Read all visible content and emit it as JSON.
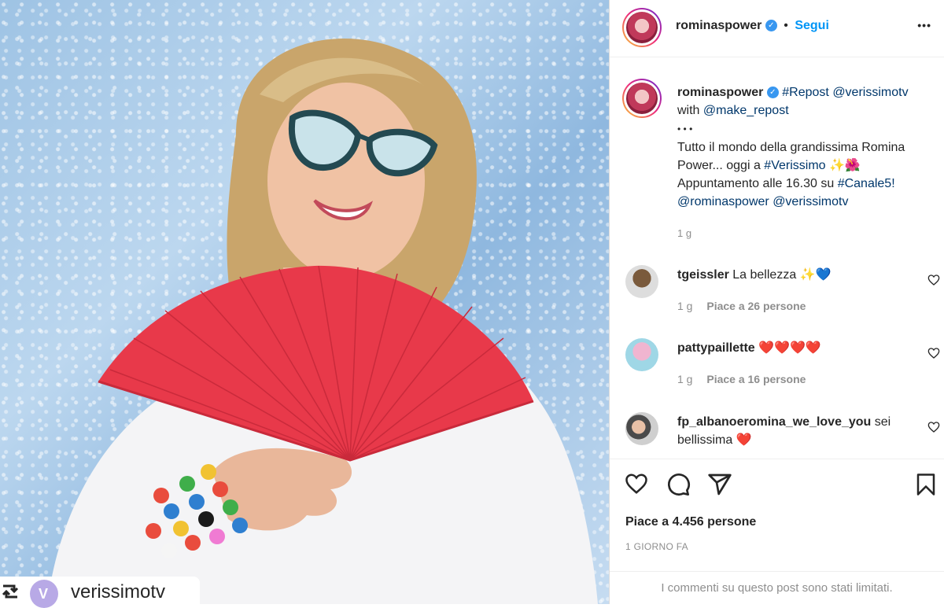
{
  "header": {
    "username": "rominaspower",
    "follow_label": "Segui",
    "more_label": "•••"
  },
  "caption": {
    "username": "rominaspower",
    "hashtag_repost": "#Repost",
    "mention_verissimotv": "@verissimotv",
    "with_text": "with",
    "mention_make_repost": "@make_repost",
    "dots": "• • •",
    "line1": "Tutto il mondo della grandissima Romina Power... oggi a ",
    "hashtag_verissimo": "#Verissimo",
    "emojis1": "✨🌺",
    "line2": "Appuntamento alle 16.30 su ",
    "hashtag_canale5": "#Canale5!",
    "mention_romina": "@rominaspower",
    "mention_verissimo2": "@verissimotv",
    "time": "1 g"
  },
  "comments": [
    {
      "username": "tgeissler",
      "text": "La bellezza",
      "emojis": "✨💙",
      "time": "1 g",
      "likes": "Piace a 26 persone"
    },
    {
      "username": "pattypaillette",
      "text": "",
      "emojis": "❤️❤️❤️❤️",
      "time": "1 g",
      "likes": "Piace a 16 persone"
    },
    {
      "username": "fp_albanoeromina_we_love_you",
      "text": "sei bellissima",
      "emojis": "❤️",
      "time": "",
      "likes": ""
    }
  ],
  "post": {
    "likes": "Piace a 4.456 persone",
    "date": "1 GIORNO FA",
    "limited": "I commenti su questo post sono stati limitati."
  },
  "watermark": {
    "repost_icon": "repost-icon",
    "handle": "verissimotv"
  },
  "colors": {
    "accent": "#0095f6",
    "link": "#00376b",
    "verified": "#3897f0",
    "fan": "#e8394a"
  }
}
